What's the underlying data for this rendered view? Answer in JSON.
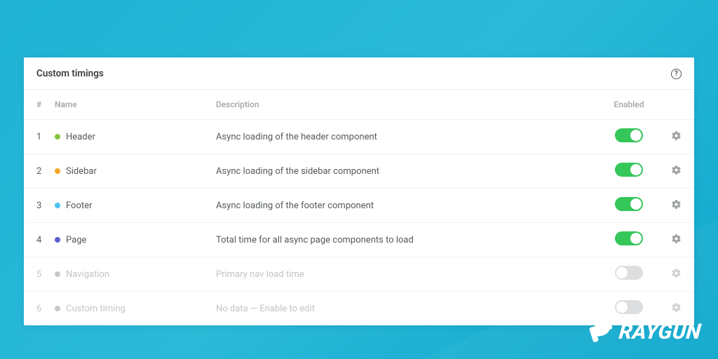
{
  "panel": {
    "title": "Custom timings"
  },
  "columns": {
    "num": "#",
    "name": "Name",
    "description": "Description",
    "enabled": "Enabled"
  },
  "rows": [
    {
      "num": "1",
      "name": "Header",
      "desc": "Async loading of the header component",
      "color": "#86c63e",
      "enabled": true,
      "active": true
    },
    {
      "num": "2",
      "name": "Sidebar",
      "desc": "Async loading of the sidebar component",
      "color": "#f5a623",
      "enabled": true,
      "active": true
    },
    {
      "num": "3",
      "name": "Footer",
      "desc": "Async loading of the footer component",
      "color": "#4ec3f0",
      "enabled": true,
      "active": true
    },
    {
      "num": "4",
      "name": "Page",
      "desc": "Total time for all async page components to load",
      "color": "#5a5fd1",
      "enabled": true,
      "active": true
    },
    {
      "num": "5",
      "name": "Navigation",
      "desc": "Primary nav load time",
      "color": "#c7cacb",
      "enabled": false,
      "active": false
    },
    {
      "num": "6",
      "name": "Custom timing",
      "desc": "No data — Enable to edit",
      "color": "#c7cacb",
      "enabled": false,
      "active": false
    }
  ],
  "brand": {
    "name": "RAYGUN"
  }
}
